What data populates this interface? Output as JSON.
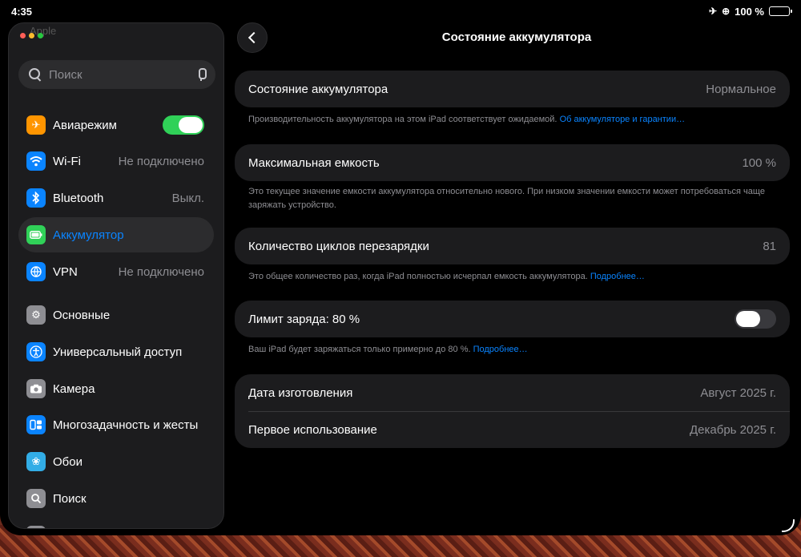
{
  "status_bar": {
    "time": "4:35",
    "battery_pct": "100 %"
  },
  "sidebar": {
    "ghost_label": "Apple",
    "search_placeholder": "Поиск",
    "items": [
      {
        "label": "Авиарежим",
        "icon": "airplane-icon",
        "toggle": "on"
      },
      {
        "label": "Wi-Fi",
        "icon": "wifi-icon",
        "value": "Не подключено"
      },
      {
        "label": "Bluetooth",
        "icon": "bluetooth-icon",
        "value": "Выкл."
      },
      {
        "label": "Аккумулятор",
        "icon": "battery-icon",
        "selected": true
      },
      {
        "label": "VPN",
        "icon": "vpn-icon",
        "value": "Не подключено"
      },
      {
        "label": "Основные",
        "icon": "gear-icon"
      },
      {
        "label": "Универсальный доступ",
        "icon": "accessibility-icon"
      },
      {
        "label": "Камера",
        "icon": "camera-icon"
      },
      {
        "label": "Многозадачность и жесты",
        "icon": "multitasking-icon"
      },
      {
        "label": "Обои",
        "icon": "wallpaper-icon"
      },
      {
        "label": "Поиск",
        "icon": "search-icon"
      }
    ],
    "colors": {
      "airplane": "#ff9500",
      "wifi": "#0a84ff",
      "bluetooth": "#0a84ff",
      "battery": "#30d158",
      "vpn": "#0a84ff",
      "general": "#8e8e93",
      "accessibility": "#0a84ff",
      "camera": "#8e8e93",
      "multitasking": "#0a84ff",
      "wallpaper": "#32ade6",
      "search": "#8e8e93"
    }
  },
  "main": {
    "title": "Состояние аккумулятора",
    "health": {
      "label": "Состояние аккумулятора",
      "value": "Нормальное",
      "note": "Производительность аккумулятора на этом iPad соответствует ожидаемой.",
      "note_link": "Об аккумуляторе и гарантии…"
    },
    "capacity": {
      "label": "Максимальная емкость",
      "value": "100 %",
      "note": "Это текущее значение емкости аккумулятора относительно нового. При низком значении емкости может потребоваться чаще заряжать устройство."
    },
    "cycles": {
      "label": "Количество циклов перезарядки",
      "value": "81",
      "note": "Это общее количество раз, когда iPad полностью исчерпал емкость аккумулятора.",
      "note_link": "Подробнее…"
    },
    "limit": {
      "label": "Лимит заряда: 80 %",
      "toggle": "off",
      "note": "Ваш iPad будет заряжаться только примерно до 80 %.",
      "note_link": "Подробнее…"
    },
    "dates": {
      "manufacture_label": "Дата изготовления",
      "manufacture_value": "Август 2025 г.",
      "first_use_label": "Первое использование",
      "first_use_value": "Декабрь 2025 г."
    }
  }
}
